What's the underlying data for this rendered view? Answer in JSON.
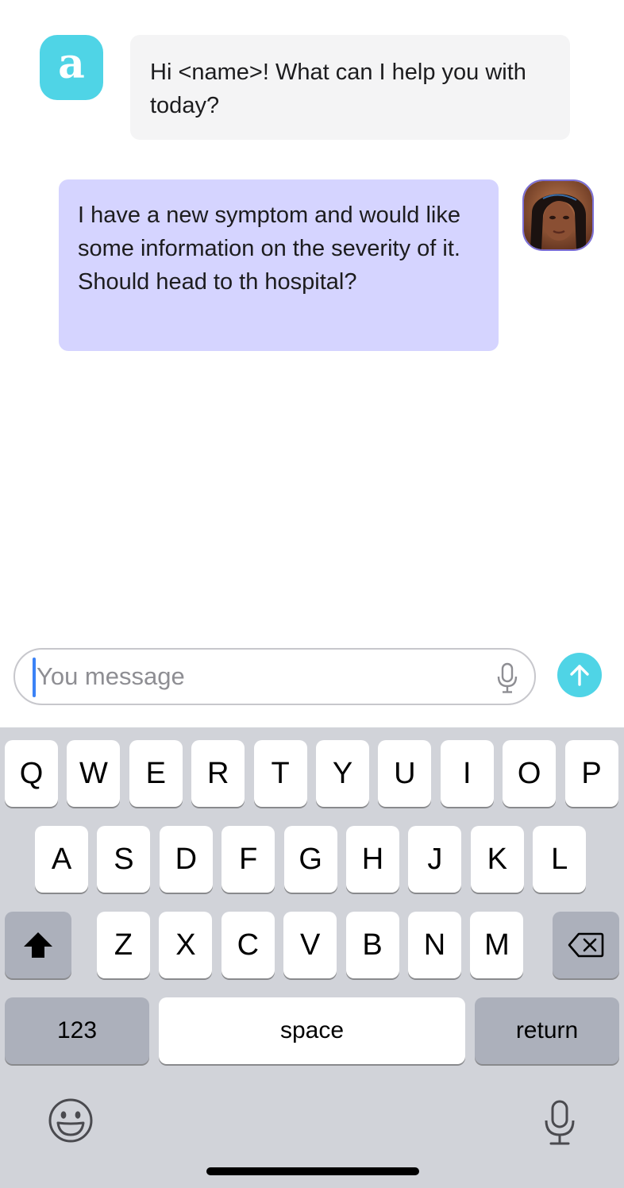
{
  "chat": {
    "bot_avatar_letter": "a",
    "bot_message": "Hi <name>! What can I help you with today?",
    "user_message": "I have a new symptom and would like some information on the severity of it. Should head to th hospital?"
  },
  "composer": {
    "placeholder": "You message",
    "mic_icon": "microphone-icon",
    "send_icon": "arrow-up-icon"
  },
  "keyboard": {
    "row1": [
      "Q",
      "W",
      "E",
      "R",
      "T",
      "Y",
      "U",
      "I",
      "O",
      "P"
    ],
    "row2": [
      "A",
      "S",
      "D",
      "F",
      "G",
      "H",
      "J",
      "K",
      "L"
    ],
    "row3": [
      "Z",
      "X",
      "C",
      "V",
      "B",
      "N",
      "M"
    ],
    "numbers_label": "123",
    "space_label": "space",
    "return_label": "return",
    "shift_icon": "shift-icon",
    "delete_icon": "delete-icon",
    "emoji_icon": "emoji-icon",
    "dictation_icon": "microphone-icon"
  },
  "colors": {
    "accent": "#4fd4e6",
    "bot_bubble": "#f4f4f5",
    "user_bubble": "#d5d4ff",
    "keyboard_bg": "#d1d3d9",
    "dark_key": "#acb0bb"
  }
}
